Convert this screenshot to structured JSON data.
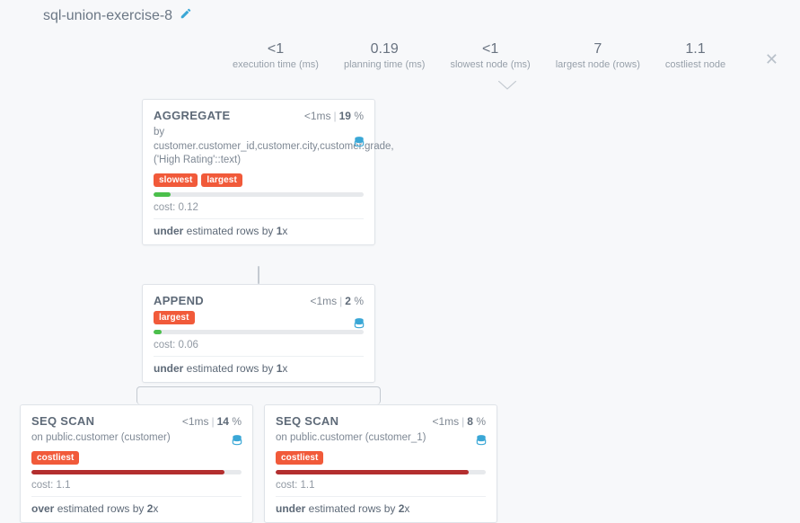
{
  "title": "sql-union-exercise-8",
  "summary": [
    {
      "value": "<1",
      "label": "execution time (ms)"
    },
    {
      "value": "0.19",
      "label": "planning time (ms)"
    },
    {
      "value": "<1",
      "label": "slowest node (ms)"
    },
    {
      "value": "7",
      "label": "largest node (rows)"
    },
    {
      "value": "1.1",
      "label": "costliest node"
    }
  ],
  "nodes": {
    "aggregate": {
      "title": "AGGREGATE",
      "ms": "<1ms",
      "pct": "19",
      "sub_prefix": "by ",
      "sub": "customer.customer_id,customer.city,customer.grade,('High Rating'::text)",
      "tags": [
        "slowest",
        "largest"
      ],
      "bar_color": "green",
      "bar_w": "8%",
      "cost_label": "cost: ",
      "cost": "0.12",
      "est_dir": "under",
      "est_mid": " estimated rows by ",
      "est_factor": "1",
      "est_x": "x"
    },
    "append": {
      "title": "APPEND",
      "ms": "<1ms",
      "pct": "2",
      "tags": [
        "largest"
      ],
      "bar_color": "green",
      "bar_w": "4%",
      "cost_label": "cost: ",
      "cost": "0.06",
      "est_dir": "under",
      "est_mid": " estimated rows by ",
      "est_factor": "1",
      "est_x": "x"
    },
    "seq1": {
      "title": "SEQ SCAN",
      "ms": "<1ms",
      "pct": "14",
      "sub_prefix": "on ",
      "sub": "public.customer (customer)",
      "tags": [
        "costliest"
      ],
      "bar_color": "red",
      "bar_w": "92%",
      "cost_label": "cost: ",
      "cost": "1.1",
      "est_dir": "over",
      "est_mid": " estimated rows by ",
      "est_factor": "2",
      "est_x": "x"
    },
    "seq2": {
      "title": "SEQ SCAN",
      "ms": "<1ms",
      "pct": "8",
      "sub_prefix": "on ",
      "sub": "public.customer (customer_1)",
      "tags": [
        "costliest"
      ],
      "bar_color": "red",
      "bar_w": "92%",
      "cost_label": "cost: ",
      "cost": "1.1",
      "est_dir": "under",
      "est_mid": " estimated rows by ",
      "est_factor": "2",
      "est_x": "x"
    }
  }
}
